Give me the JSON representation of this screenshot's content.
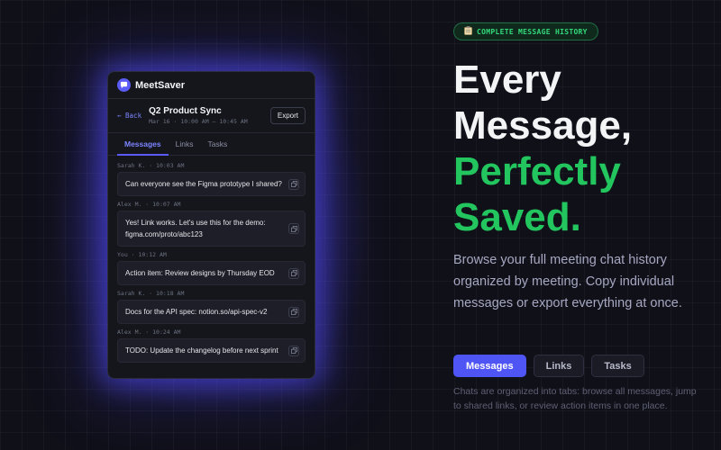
{
  "app": {
    "name": "MeetSaver",
    "meeting": {
      "back_label": "← Back",
      "title": "Q2 Product Sync",
      "time": "Mar 16 · 10:00 AM – 10:45 AM",
      "export_label": "Export"
    },
    "tabs": [
      {
        "label": "Messages",
        "active": true
      },
      {
        "label": "Links",
        "active": false
      },
      {
        "label": "Tasks",
        "active": false
      }
    ],
    "messages": [
      {
        "meta": "Sarah K. · 10:03 AM",
        "text": "Can everyone see the Figma prototype I shared?"
      },
      {
        "meta": "Alex M. · 10:07 AM",
        "text": "Yes! Link works. Let's use this for the demo: figma.com/proto/abc123"
      },
      {
        "meta": "You · 10:12 AM",
        "text": "Action item: Review designs by Thursday EOD"
      },
      {
        "meta": "Sarah K. · 10:18 AM",
        "text": "Docs for the API spec: notion.so/api-spec-v2"
      },
      {
        "meta": "Alex M. · 10:24 AM",
        "text": "TODO: Update the changelog before next sprint"
      }
    ]
  },
  "hero": {
    "badge": "COMPLETE MESSAGE HISTORY",
    "title_line1": "Every",
    "title_line2": "Message,",
    "title_line3": "Perfectly",
    "title_line4": "Saved.",
    "description": "Browse your full meeting chat history organized by meeting. Copy individual messages or export everything at once.",
    "tabs": [
      {
        "label": "Messages",
        "active": true
      },
      {
        "label": "Links",
        "active": false
      },
      {
        "label": "Tasks",
        "active": false
      }
    ],
    "caption": "Chats are organized into tabs: browse all messages, jump to shared links, or review action items in one place."
  },
  "colors": {
    "accent": "#5b5bf7",
    "green": "#22c55e",
    "background": "#101019"
  }
}
